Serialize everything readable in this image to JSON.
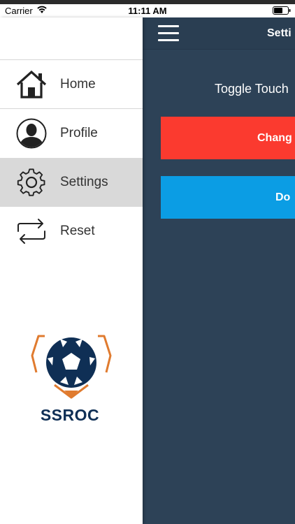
{
  "status_bar": {
    "carrier": "Carrier",
    "time": "11:11 AM"
  },
  "header": {
    "title": "Setti"
  },
  "main": {
    "toggle_label": "Toggle Touch",
    "change_button": "Chang",
    "done_button": "Do"
  },
  "menu": {
    "items": [
      {
        "label": "Home",
        "icon": "home-icon"
      },
      {
        "label": "Profile",
        "icon": "user-icon"
      },
      {
        "label": "Settings",
        "icon": "gear-icon",
        "active": true
      },
      {
        "label": "Reset",
        "icon": "refresh-icon"
      }
    ]
  },
  "logo": {
    "text": "SSROC"
  },
  "colors": {
    "panel_bg": "#2d4257",
    "change_red": "#fb3a2f",
    "done_blue": "#0b9de4",
    "active_item": "#d9d9d9",
    "logo_navy": "#0f2f55",
    "logo_orange": "#e07b2f"
  }
}
